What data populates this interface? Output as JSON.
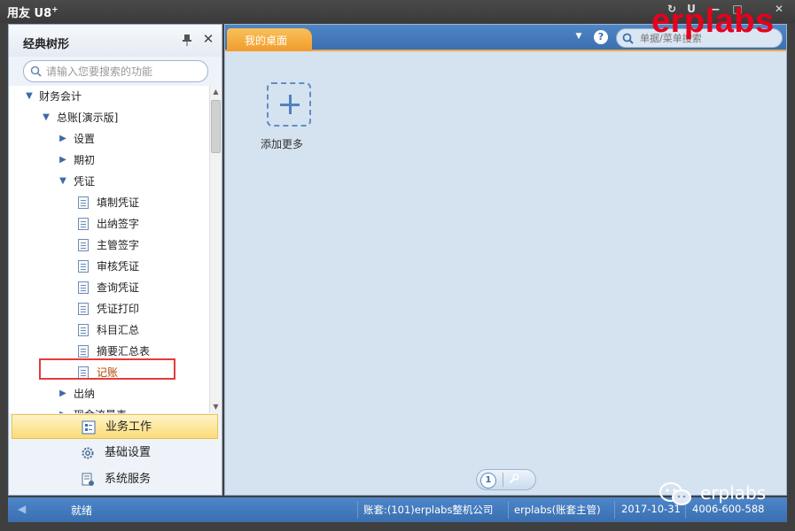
{
  "app": {
    "title": "用友 U8",
    "title_sup": "+"
  },
  "window_controls": [
    "↻",
    "U",
    "—",
    "□",
    "✕"
  ],
  "watermark": "erplabs",
  "left_panel": {
    "title": "经典树形",
    "search_placeholder": "请输入您要搜索的功能",
    "tree": [
      {
        "label": "财务会计",
        "expanded": true
      },
      {
        "label": "总账[演示版]",
        "expanded": true
      },
      {
        "label": "设置",
        "expanded": false
      },
      {
        "label": "期初",
        "expanded": false
      },
      {
        "label": "凭证",
        "expanded": true
      },
      {
        "label": "填制凭证"
      },
      {
        "label": "出纳签字"
      },
      {
        "label": "主管签字"
      },
      {
        "label": "审核凭证"
      },
      {
        "label": "查询凭证"
      },
      {
        "label": "凭证打印"
      },
      {
        "label": "科目汇总"
      },
      {
        "label": "摘要汇总表"
      },
      {
        "label": "记账",
        "selected": true
      },
      {
        "label": "出纳",
        "expanded": false
      },
      {
        "label": "现金流量表",
        "expanded": false
      }
    ],
    "nav": [
      {
        "label": "业务工作",
        "active": true
      },
      {
        "label": "基础设置"
      },
      {
        "label": "系统服务"
      }
    ]
  },
  "main": {
    "tab_label": "我的桌面",
    "search_placeholder": "单据/菜单搜索",
    "add_more_label": "添加更多",
    "page_number": "1"
  },
  "status": {
    "ready": "就绪",
    "account": "账套:(101)erplabs整机公司",
    "user": "erplabs(账套主管)",
    "date": "2017-10-31",
    "phone": "4006-600-588"
  },
  "wechat_label": "erplabs",
  "colors": {
    "accent_blue": "#3a6fb0",
    "tab_orange": "#f19c2b",
    "highlight_red": "#e53b3b",
    "selected_text": "#b34700"
  }
}
